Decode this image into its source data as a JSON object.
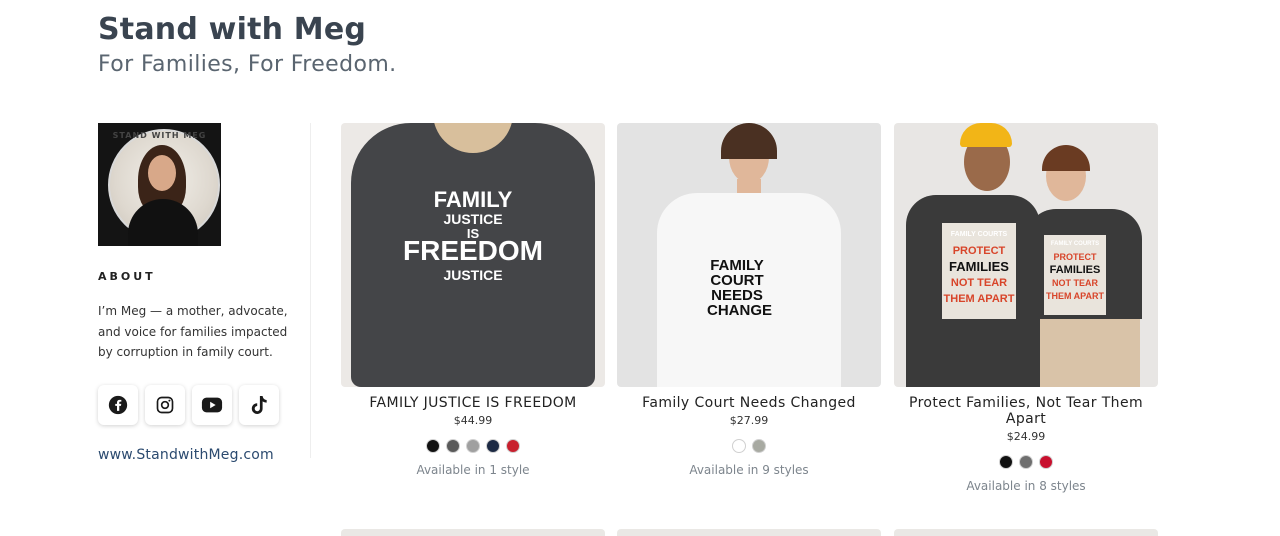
{
  "header": {
    "title": "Stand with Meg",
    "subtitle": "For Families, For Freedom."
  },
  "sidebar": {
    "avatar_ring_text": "STAND WITH MEG",
    "about_heading": "ABOUT",
    "about_text": "I’m Meg — a mother, advocate, and voice for families impacted by corruption in family court.",
    "social": [
      {
        "name": "facebook-icon"
      },
      {
        "name": "instagram-icon"
      },
      {
        "name": "youtube-icon"
      },
      {
        "name": "tiktok-icon"
      }
    ],
    "website": "www.StandwithMeg.com"
  },
  "products": [
    {
      "name": "FAMILY JUSTICE IS FREEDOM",
      "price": "$44.99",
      "swatches": [
        "#111111",
        "#5a5a5a",
        "#a0a0a0",
        "#1d2a44",
        "#c8202e"
      ],
      "availability": "Available in 1 style",
      "print": [
        "FAMILY",
        "JUSTICE",
        "IS",
        "FREEDOM",
        "JUSTICE"
      ]
    },
    {
      "name": "Family Court Needs Changed",
      "price": "$27.99",
      "swatches": [
        "#ffffff",
        "#a8aaa2"
      ],
      "availability": "Available in 9 styles",
      "print": [
        "FAMILY",
        "COURT",
        "NEEDS",
        "CHANGE"
      ]
    },
    {
      "name": "Protect Families, Not Tear Them Apart",
      "price": "$24.99",
      "swatches": [
        "#111111",
        "#6f6f6f",
        "#c8102e"
      ],
      "availability": "Available in 8 styles",
      "print": [
        "FAMILY COURTS",
        "PROTECT",
        "FAMILIES",
        "NOT TEAR",
        "THEM APART"
      ]
    }
  ]
}
